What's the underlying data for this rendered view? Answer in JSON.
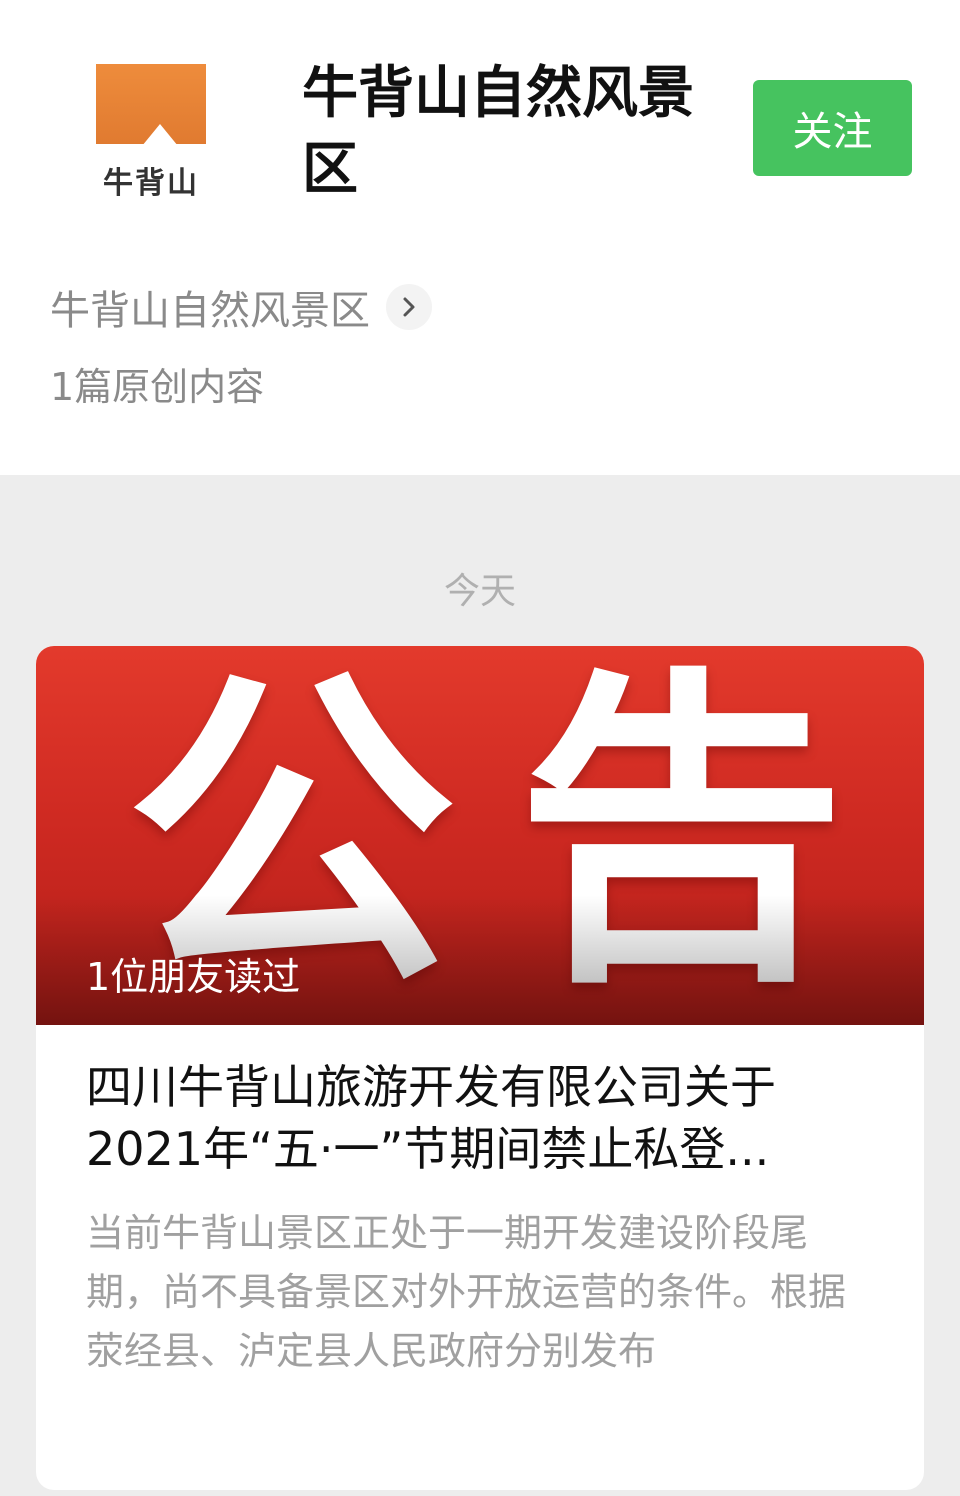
{
  "account": {
    "logo_text": "牛背山",
    "name": "牛背山自然风景区",
    "follow_label": "关注",
    "sub_name": "牛背山自然风景区",
    "original_count": "1篇原创内容"
  },
  "feed": {
    "date_label": "今天",
    "articles": [
      {
        "cover_text": "公告",
        "cover_char_1": "公",
        "cover_char_2": "告",
        "read_by": "1位朋友读过",
        "title": "四川牛背山旅游开发有限公司关于2021年“五·一”节期间禁止私登...",
        "summary": "当前牛背山景区正处于一期开发建设阶段尾期，尚不具备景区对外开放运营的条件。根据荥经县、泸定县人民政府分别发布"
      }
    ]
  },
  "colors": {
    "follow_green": "#46c35f",
    "logo_orange": "#e8843a",
    "cover_red": "#d32d24"
  },
  "icons": {
    "chevron": "chevron-right-icon"
  }
}
